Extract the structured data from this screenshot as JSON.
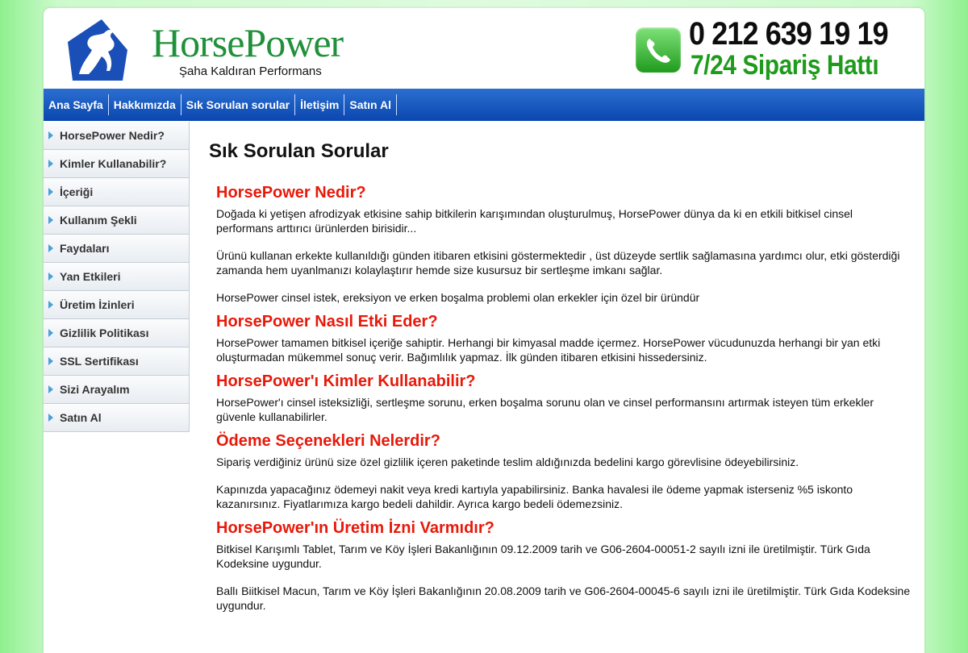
{
  "header": {
    "brand_name": "HorsePower",
    "tagline": "Şaha Kaldıran Performans",
    "phone": "0 212 639 19 19",
    "phone_sub": "7/24 Sipariş Hattı"
  },
  "nav": {
    "items": [
      "Ana Sayfa",
      "Hakkımızda",
      "Sık Sorulan sorular",
      "İletişim",
      "Satın Al"
    ]
  },
  "sidebar": {
    "items": [
      "HorsePower Nedir?",
      "Kimler Kullanabilir?",
      "İçeriği",
      "Kullanım Şekli",
      "Faydaları",
      "Yan Etkileri",
      "Üretim İzinleri",
      "Gizlilik Politikası",
      "SSL Sertifikası",
      "Sizi Arayalım",
      "Satın Al"
    ]
  },
  "content": {
    "title": "Sık Sorulan Sorular",
    "sections": [
      {
        "heading": "HorsePower Nedir?",
        "paragraphs": [
          "Doğada ki yetişen afrodizyak etkisine sahip bitkilerin karışımından oluşturulmuş, HorsePower dünya da ki en etkili bitkisel cinsel performans arttırıcı ürünlerden birisidir...",
          "Ürünü kullanan erkekte kullanıldığı günden itibaren etkisini göstermektedir , üst düzeyde sertlik sağlamasına yardımcı olur, etki gösterdiği zamanda hem uyanlmanızı kolaylaştırır hemde size kusursuz bir sertleşme imkanı sağlar.",
          "HorsePower cinsel istek, ereksiyon ve erken boşalma problemi olan erkekler için özel bir üründür"
        ]
      },
      {
        "heading": "HorsePower Nasıl Etki Eder?",
        "paragraphs": [
          "HorsePower tamamen bitkisel içeriğe sahiptir. Herhangi bir kimyasal madde içermez. HorsePower vücudunuzda herhangi bir yan etki oluşturmadan mükemmel sonuç verir. Bağımlılık yapmaz. İlk günden itibaren etkisini hissedersiniz."
        ]
      },
      {
        "heading": "HorsePower'ı Kimler Kullanabilir?",
        "paragraphs": [
          "HorsePower'ı cinsel isteksizliği, sertleşme sorunu, erken boşalma sorunu olan ve cinsel performansını artırmak isteyen tüm erkekler güvenle kullanabilirler."
        ]
      },
      {
        "heading": "Ödeme Seçenekleri Nelerdir?",
        "paragraphs": [
          "Sipariş verdiğiniz ürünü size özel gizlilik içeren paketinde teslim aldığınızda bedelini kargo görevlisine ödeyebilirsiniz.",
          "Kapınızda yapacağınız ödemeyi nakit veya kredi kartıyla yapabilirsiniz. Banka havalesi ile ödeme yapmak isterseniz %5 iskonto kazanırsınız. Fiyatlarımıza kargo bedeli dahildir. Ayrıca kargo bedeli ödemezsiniz."
        ]
      },
      {
        "heading": "HorsePower'ın Üretim İzni Varmıdır?",
        "paragraphs": [
          "Bitkisel Karışımlı Tablet, Tarım ve Köy İşleri Bakanlığının 09.12.2009 tarih ve G06-2604-00051-2 sayılı izni ile üretilmiştir. Türk Gıda Kodeksine uygundur.",
          "Ballı Biitkisel Macun, Tarım ve Köy İşleri Bakanlığının 20.08.2009 tarih ve G06-2604-00045-6 sayılı izni ile üretilmiştir. Türk Gıda Kodeksine uygundur."
        ]
      }
    ]
  },
  "colors": {
    "brand_green": "#21903a",
    "nav_blue": "#0a47b0",
    "heading_red": "#e8190a"
  }
}
